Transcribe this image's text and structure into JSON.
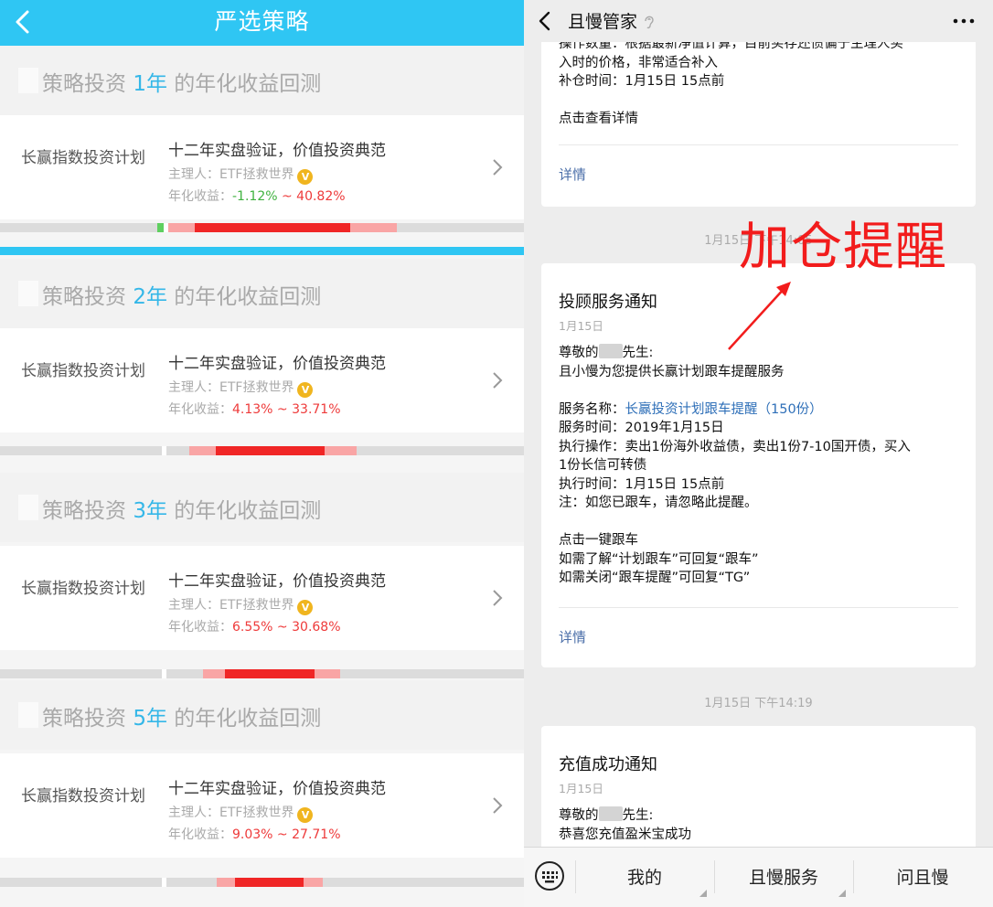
{
  "left": {
    "header": {
      "title": "严选策略"
    },
    "sections": [
      {
        "title_pre": "策略投资",
        "years": "1年",
        "title_post": "的年化收益回测",
        "plan": "长赢指数投资计划",
        "slogan": "十二年实盘验证，价值投资典范",
        "manager_label": "主理人：ETF拯救世界",
        "returns_label": "年化收益：",
        "ret_low": "-1.12%",
        "ret_sep": " ~ ",
        "ret_high": "40.82%"
      },
      {
        "title_pre": "策略投资",
        "years": "2年",
        "title_post": "的年化收益回测",
        "plan": "长赢指数投资计划",
        "slogan": "十二年实盘验证，价值投资典范",
        "manager_label": "主理人：ETF拯救世界",
        "returns_label": "年化收益：",
        "ret_low": "4.13%",
        "ret_sep": " ~ ",
        "ret_high": "33.71%"
      },
      {
        "title_pre": "策略投资",
        "years": "3年",
        "title_post": "的年化收益回测",
        "plan": "长赢指数投资计划",
        "slogan": "十二年实盘验证，价值投资典范",
        "manager_label": "主理人：ETF拯救世界",
        "returns_label": "年化收益：",
        "ret_low": "6.55%",
        "ret_sep": " ~ ",
        "ret_high": "30.68%"
      },
      {
        "title_pre": "策略投资",
        "years": "5年",
        "title_post": "的年化收益回测",
        "plan": "长赢指数投资计划",
        "slogan": "十二年实盘验证，价值投资典范",
        "manager_label": "主理人：ETF拯救世界",
        "returns_label": "年化收益：",
        "ret_low": "9.03%",
        "ret_sep": " ~ ",
        "ret_high": "27.71%"
      }
    ],
    "badge": "V"
  },
  "right": {
    "header": {
      "title": "且慢管家"
    },
    "msg1": {
      "line0": "操作数量：根据最新净值计算，目前买存还债偏于主理人买",
      "line1": "入时的价格，非常适合补入",
      "line2": "补仓时间：1月15日 15点前",
      "line3": "点击查看详情",
      "detail": "详情"
    },
    "timestamp1": "1月15日 下午14:05",
    "annotation": "加仓提醒",
    "msg2": {
      "title": "投顾服务通知",
      "date": "1月15日",
      "greet_pre": "尊敬的",
      "greet_post": "先生:",
      "intro": "且小慢为您提供长赢计划跟车提醒服务",
      "svc_label": "服务名称：",
      "svc_name": "长赢投资计划跟车提醒（150份）",
      "time": "服务时间：2019年1月15日",
      "op1": "执行操作：卖出1份海外收益债，卖出1份7-10国开债，买入",
      "op2": "1份长信可转债",
      "exec": "执行时间：1月15日 15点前",
      "note": "注：如您已跟车，请忽略此提醒。",
      "follow": "点击一键跟车",
      "hint1": "如需了解“计划跟车”可回复“跟车”",
      "hint2": "如需关闭“跟车提醒”可回复“TG”",
      "detail": "详情"
    },
    "timestamp2": "1月15日 下午14:19",
    "msg3": {
      "title": "充值成功通知",
      "date": "1月15日",
      "greet_pre": "尊敬的",
      "greet_post": "先生:",
      "body": "恭喜您充值盈米宝成功"
    },
    "bottom": {
      "tab1": "我的",
      "tab2": "且慢服务",
      "tab3": "问且慢"
    }
  }
}
